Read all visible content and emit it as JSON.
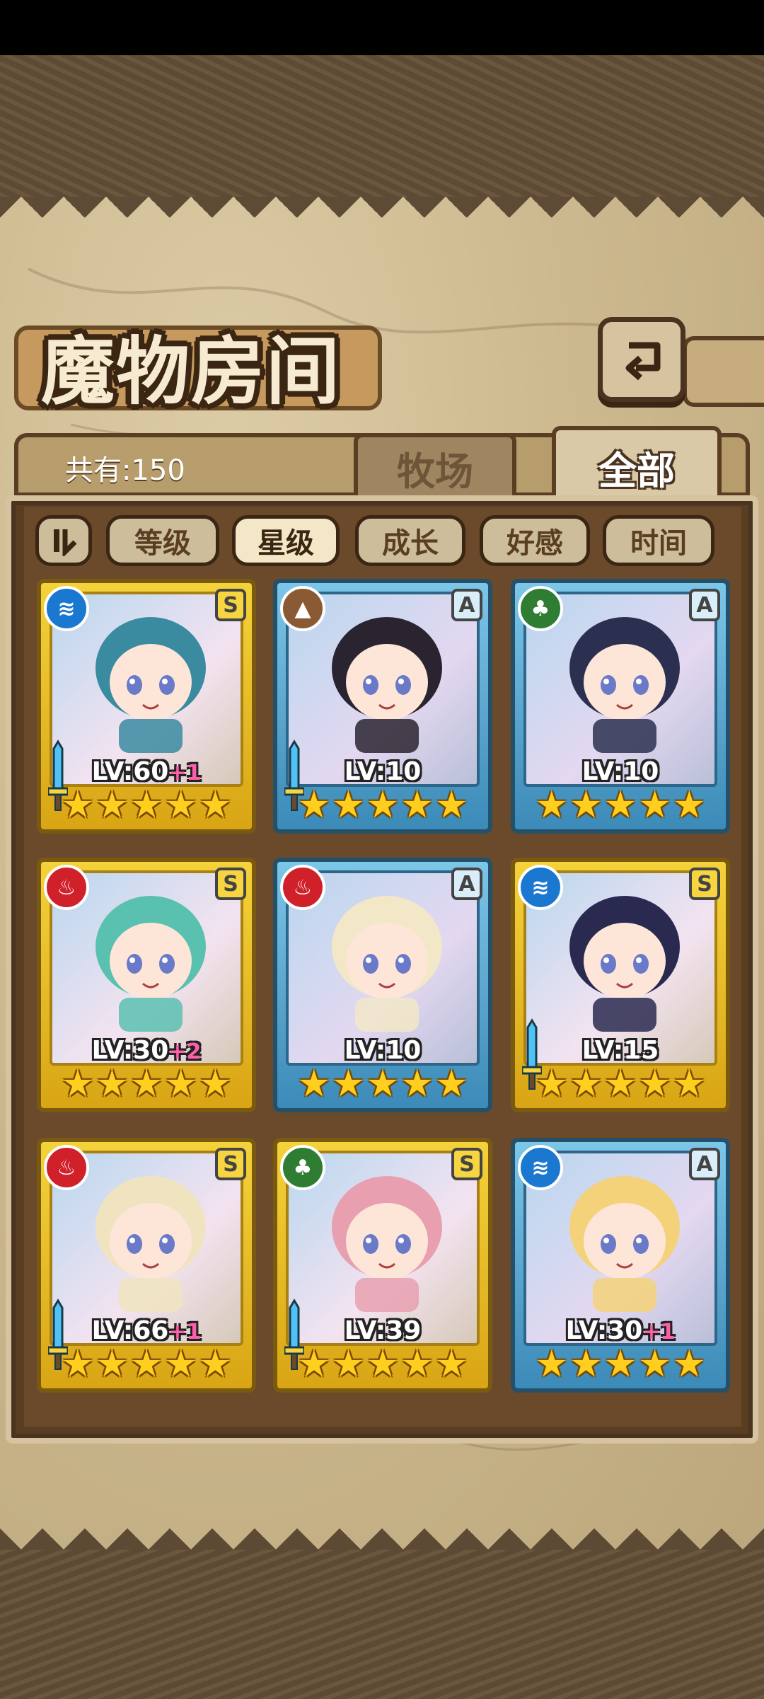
{
  "title": "魔物房间",
  "count_label": "共有:150",
  "tabs": [
    {
      "label": "牧场",
      "active": false
    },
    {
      "label": "全部",
      "active": true
    }
  ],
  "sort_buttons": [
    {
      "label": "等级",
      "active": false
    },
    {
      "label": "星级",
      "active": true
    },
    {
      "label": "成长",
      "active": false
    },
    {
      "label": "好感",
      "active": false
    },
    {
      "label": "时间",
      "active": false
    }
  ],
  "icons": {
    "back": "back-arrow-icon",
    "sort_toggle": "sort-order-icon"
  },
  "colors": {
    "s_rank": "#f4d23a",
    "a_rank": "#7cc6e8",
    "water": "#1b78d0",
    "fire": "#d0202a",
    "earth": "#8a5a35",
    "wood": "#2e7d32"
  },
  "monsters": [
    {
      "element": "water",
      "rank": "S",
      "level": "LV:60",
      "bonus": "+1",
      "stars": 5,
      "has_weapon": true
    },
    {
      "element": "earth",
      "rank": "A",
      "level": "LV:10",
      "bonus": "",
      "stars": 5,
      "has_weapon": true
    },
    {
      "element": "wood",
      "rank": "A",
      "level": "LV:10",
      "bonus": "",
      "stars": 5,
      "has_weapon": false
    },
    {
      "element": "fire",
      "rank": "S",
      "level": "LV:30",
      "bonus": "+2",
      "stars": 5,
      "has_weapon": false
    },
    {
      "element": "fire",
      "rank": "A",
      "level": "LV:10",
      "bonus": "",
      "stars": 5,
      "has_weapon": false
    },
    {
      "element": "water",
      "rank": "S",
      "level": "LV:15",
      "bonus": "",
      "stars": 5,
      "has_weapon": true
    },
    {
      "element": "fire",
      "rank": "S",
      "level": "LV:66",
      "bonus": "+1",
      "stars": 5,
      "has_weapon": true
    },
    {
      "element": "wood",
      "rank": "S",
      "level": "LV:39",
      "bonus": "",
      "stars": 5,
      "has_weapon": true
    },
    {
      "element": "water",
      "rank": "A",
      "level": "LV:30",
      "bonus": "+1",
      "stars": 5,
      "has_weapon": false
    }
  ]
}
